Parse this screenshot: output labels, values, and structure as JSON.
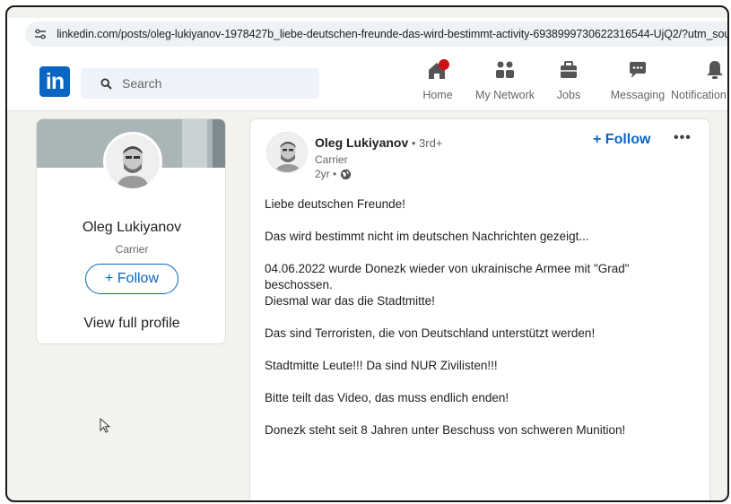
{
  "browser": {
    "url": "linkedin.com/posts/oleg-lukiyanov-1978427b_liebe-deutschen-freunde-das-wird-bestimmt-activity-6938999730622316544-UjQ2/?utm_source="
  },
  "nav": {
    "search_placeholder": "Search",
    "items": [
      {
        "label": "Home",
        "icon": "home-icon"
      },
      {
        "label": "My Network",
        "icon": "people-icon"
      },
      {
        "label": "Jobs",
        "icon": "briefcase-icon"
      },
      {
        "label": "Messaging",
        "icon": "chat-icon"
      },
      {
        "label": "Notification",
        "icon": "bell-icon"
      }
    ],
    "notification_dot_color": "#cc1016",
    "brand_color": "#0a66c2",
    "logo_text": "in"
  },
  "profile_card": {
    "name": "Oleg Lukiyanov",
    "title": "Carrier",
    "follow_label": "+ Follow",
    "view_profile_label": "View full profile"
  },
  "post": {
    "author": "Oleg Lukiyanov",
    "degree": " • 3rd+",
    "author_title": "Carrier",
    "time": "2yr •",
    "follow_label": "+ Follow",
    "more_label": "•••",
    "paragraphs": [
      "Liebe deutschen Freunde!",
      "Das wird bestimmt nicht im deutschen Nachrichten gezeigt...",
      "04.06.2022 wurde Donezk wieder von ukrainische Armee mit \"Grad\" beschossen.",
      "Diesmal war das die Stadtmitte!",
      "Das sind Terroristen, die von Deutschland unterstützt werden!",
      "Stadtmitte Leute!!! Da sind NUR Zivilisten!!!",
      "Bitte teilt das Video, das muss endlich enden!",
      "Donezk steht seit 8 Jahren unter Beschuss von schweren Munition!"
    ]
  }
}
